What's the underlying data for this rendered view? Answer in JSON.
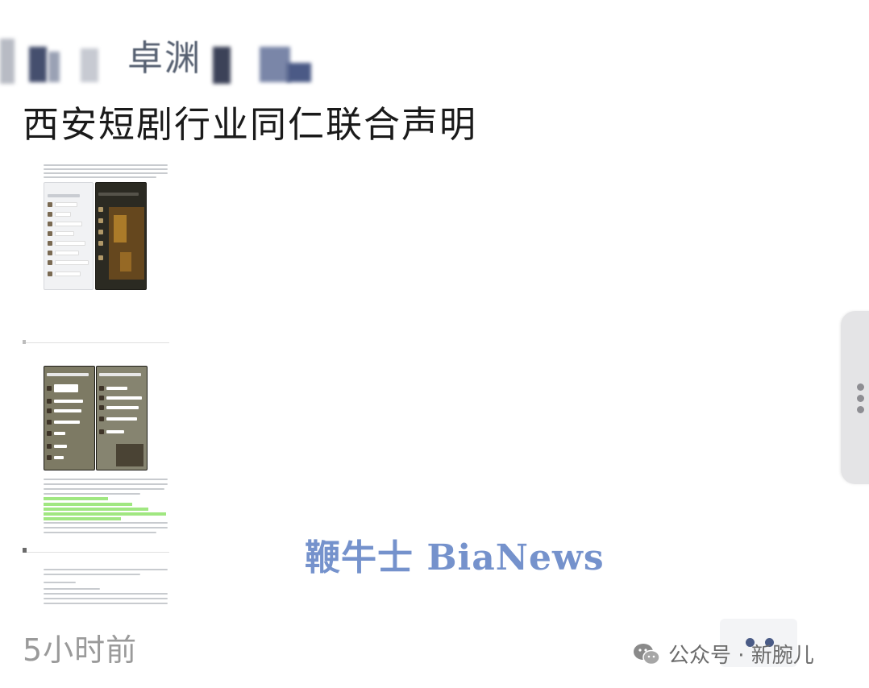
{
  "header": {
    "author_name": "卓渊"
  },
  "post": {
    "title": "西安短剧行业同仁联合声明",
    "timestamp": "5小时前"
  },
  "image": {
    "icon": "long-screenshot-image",
    "phone_light_color": "#f1f2f4",
    "phone_dark_color": "#2b2a22",
    "highlight_color": "#8fe36b"
  },
  "watermark": {
    "text": "鞭牛士 BiaNews",
    "color": "#5e7fc4"
  },
  "footer": {
    "source_text": "公众号 · 新腕儿",
    "source_icon": "wechat-icon",
    "more_icon": "more-dots-icon"
  },
  "drawer": {
    "icon": "vertical-dots-icon"
  }
}
